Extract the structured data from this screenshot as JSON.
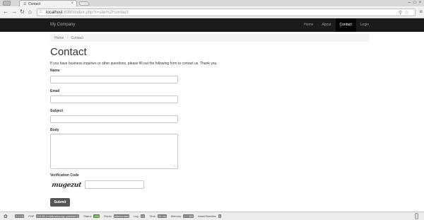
{
  "browser": {
    "tab_title": "Contact",
    "tab_favicon": "network-icon",
    "url_host": "localhost",
    "url_rest": ":8080/index.php?r=site%2Fcontact"
  },
  "navbar": {
    "brand": "My Company",
    "items": [
      {
        "label": "Home",
        "active": false
      },
      {
        "label": "About",
        "active": false
      },
      {
        "label": "Contact",
        "active": true
      },
      {
        "label": "Login",
        "active": false
      }
    ]
  },
  "breadcrumb": {
    "items": [
      "Home",
      "Contact"
    ],
    "separator": "/"
  },
  "page": {
    "title": "Contact",
    "intro": "If you have business inquiries or other questions, please fill out the following form to contact us. Thank you.",
    "labels": {
      "name": "Name",
      "email": "Email",
      "subject": "Subject",
      "body": "Body",
      "verification": "Verification Code"
    },
    "captcha_text": "mugezut",
    "submit_label": "Submit"
  },
  "debugbar": {
    "items": [
      {
        "label": "",
        "value": "2.0.15"
      },
      {
        "label": "PHP",
        "value": "5.5.38-1+deb.sury.org~precise+1"
      },
      {
        "label": "Status",
        "value": "200"
      },
      {
        "label": "Route",
        "value": "site/contact"
      },
      {
        "label": "Log",
        "value": "12"
      },
      {
        "label": "Time",
        "value": "26 ms"
      },
      {
        "label": "Memory",
        "value": "2.7 MB"
      },
      {
        "label": "Asset Bundles",
        "value": "5"
      }
    ]
  }
}
